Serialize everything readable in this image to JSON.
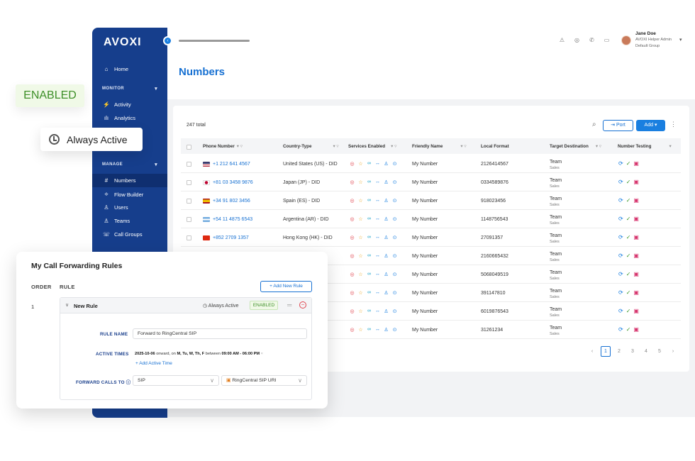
{
  "sidebar": {
    "logo": "AVOXI",
    "home": "Home",
    "monitor_section": "MONITOR",
    "activity": "Activity",
    "analytics": "Analytics",
    "manage_section": "MANAGE",
    "numbers": "Numbers",
    "flow_builder": "Flow Builder",
    "users": "Users",
    "teams": "Teams",
    "call_groups": "Call Groups"
  },
  "header": {
    "page_title": "Numbers",
    "user_name": "Jane Doe",
    "user_role": "AVOXI Helper Admin",
    "user_group": "Default Group"
  },
  "toolbar": {
    "total": "247 total",
    "port_label": "Port",
    "add_label": "Add"
  },
  "table": {
    "headers": {
      "phone": "Phone Number",
      "country": "Country-Type",
      "services": "Services Enabled",
      "friendly": "Friendly Name",
      "local": "Local Format",
      "target": "Target Destination",
      "testing": "Number Testing"
    },
    "rows": [
      {
        "phone": "+1 212 641 4567",
        "country": "United States (US) - DID",
        "friendly": "My Number",
        "local": "2126414567",
        "target": "Team",
        "target_sub": "Sales",
        "flag": "us"
      },
      {
        "phone": "+81 03 3458 9876",
        "country": "Japan (JP) - DID",
        "friendly": "My Number",
        "local": "0334589876",
        "target": "Team",
        "target_sub": "Sales",
        "flag": "jp"
      },
      {
        "phone": "+34 91 802 3456",
        "country": "Spain (ES) - DID",
        "friendly": "My Number",
        "local": "918023456",
        "target": "Team",
        "target_sub": "Sales",
        "flag": "es"
      },
      {
        "phone": "+54 11 4875 6543",
        "country": "Argentina (AR) - DID",
        "friendly": "My Number",
        "local": "1148756543",
        "target": "Team",
        "target_sub": "Sales",
        "flag": "ar"
      },
      {
        "phone": "+852 2709 1357",
        "country": "Hong Kong (HK) - DID",
        "friendly": "My Number",
        "local": "27091357",
        "target": "Team",
        "target_sub": "Sales",
        "flag": "hk"
      },
      {
        "phone": "",
        "country": "",
        "friendly": "My Number",
        "local": "2160665432",
        "target": "Team",
        "target_sub": "Sales",
        "flag": ""
      },
      {
        "phone": "",
        "country": "",
        "friendly": "My Number",
        "local": "5068049519",
        "target": "Team",
        "target_sub": "Sales",
        "flag": ""
      },
      {
        "phone": "",
        "country": "",
        "friendly": "My Number",
        "local": "391147810",
        "target": "Team",
        "target_sub": "Sales",
        "flag": ""
      },
      {
        "phone": "",
        "country": "",
        "friendly": "My Number",
        "local": "6019876543",
        "target": "Team",
        "target_sub": "Sales",
        "flag": ""
      },
      {
        "phone": "",
        "country": "",
        "friendly": "My Number",
        "local": "31261234",
        "target": "Team",
        "target_sub": "Sales",
        "flag": ""
      }
    ]
  },
  "pagination": {
    "pages": [
      "1",
      "2",
      "3",
      "4",
      "5"
    ],
    "prev": "‹",
    "next": "›"
  },
  "floating": {
    "enabled": "ENABLED",
    "always_active": "Always Active"
  },
  "call_forwarding": {
    "title": "My Call Forwarding Rules",
    "order_header": "ORDER",
    "rule_header": "RULE",
    "add_rule": "Add New Rule",
    "order_number": "1",
    "rule_title": "New Rule",
    "rule_status_text": "Always Active",
    "rule_badge": "ENABLED",
    "rule_name_label": "RULE NAME",
    "rule_name_value": "Forward to RingCentral SIP",
    "active_times_label": "ACTIVE TIMES",
    "active_times_date": "2025-10-06",
    "active_times_onward": "onward, on",
    "active_times_days": "M, Tu, W, Th, F",
    "active_times_between": "between",
    "active_times_range": "09:00 AM - 06:00 PM",
    "add_active_time": "Add Active Time",
    "forward_label": "FORWARD CALLS TO",
    "forward_type": "SIP",
    "forward_target": "RingCentral SIP URI"
  },
  "colors": {
    "brand": "#163e8c",
    "accent": "#1670d2",
    "enabled": "#3d8f28"
  }
}
